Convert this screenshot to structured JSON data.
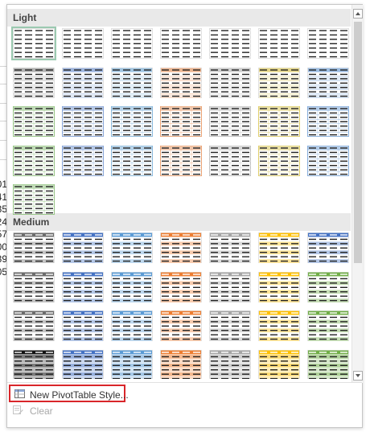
{
  "sections": [
    {
      "title": "Light",
      "style_count": 29,
      "selected_index": 0,
      "tones": [
        "#8a8a8a",
        "#6b8fcf",
        "#6ea8d4",
        "#e58e55",
        "#b5b5b5",
        "#d8c24a",
        "#6a9bd4",
        "#8a8a8a",
        "#6b8fcf",
        "#6ea8d4",
        "#e58e55",
        "#b5b5b5",
        "#d8c24a",
        "#6a9bd4",
        "#7fb76a",
        "#6b8fcf",
        "#6ea8d4",
        "#e58e55",
        "#b5b5b5",
        "#d8c24a",
        "#6a9bd4",
        "#7fb76a",
        "#6b8fcf",
        "#6ea8d4",
        "#e58e55",
        "#b5b5b5",
        "#d8c24a",
        "#6a9bd4",
        "#7fb76a"
      ]
    },
    {
      "title": "Medium",
      "style_count": 35,
      "tones": [
        "#6c6c6c",
        "#4472c4",
        "#5b9bd5",
        "#ed7d31",
        "#a5a5a5",
        "#ffc000",
        "#4472c4",
        "#6c6c6c",
        "#4472c4",
        "#5b9bd5",
        "#ed7d31",
        "#a5a5a5",
        "#ffc000",
        "#70ad47",
        "#6c6c6c",
        "#4472c4",
        "#5b9bd5",
        "#ed7d31",
        "#a5a5a5",
        "#ffc000",
        "#70ad47",
        "#111111",
        "#4472c4",
        "#5b9bd5",
        "#ed7d31",
        "#a5a5a5",
        "#ffc000",
        "#70ad47",
        "#7f7f7f",
        "#4472c4",
        "#5b9bd5",
        "#ed7d31",
        "#a5a5a5",
        "#ffc000",
        "#70ad47"
      ]
    }
  ],
  "menu": {
    "new_style_label": "New PivotTable Style...",
    "clear_label": "Clear"
  },
  "colors": {
    "highlight": "#d9262a",
    "selected_border": "#9bc9b0",
    "header_bg": "#e9e9e9"
  },
  "icons": {
    "new_style": "new-style-icon",
    "clear": "clear-icon",
    "scroll_up": "chevron-up-icon",
    "scroll_down": "chevron-down-icon"
  },
  "background_sheet": {
    "row_numbers": [
      "01",
      "41",
      "35",
      "24",
      "57",
      "00",
      "39",
      "05"
    ]
  }
}
